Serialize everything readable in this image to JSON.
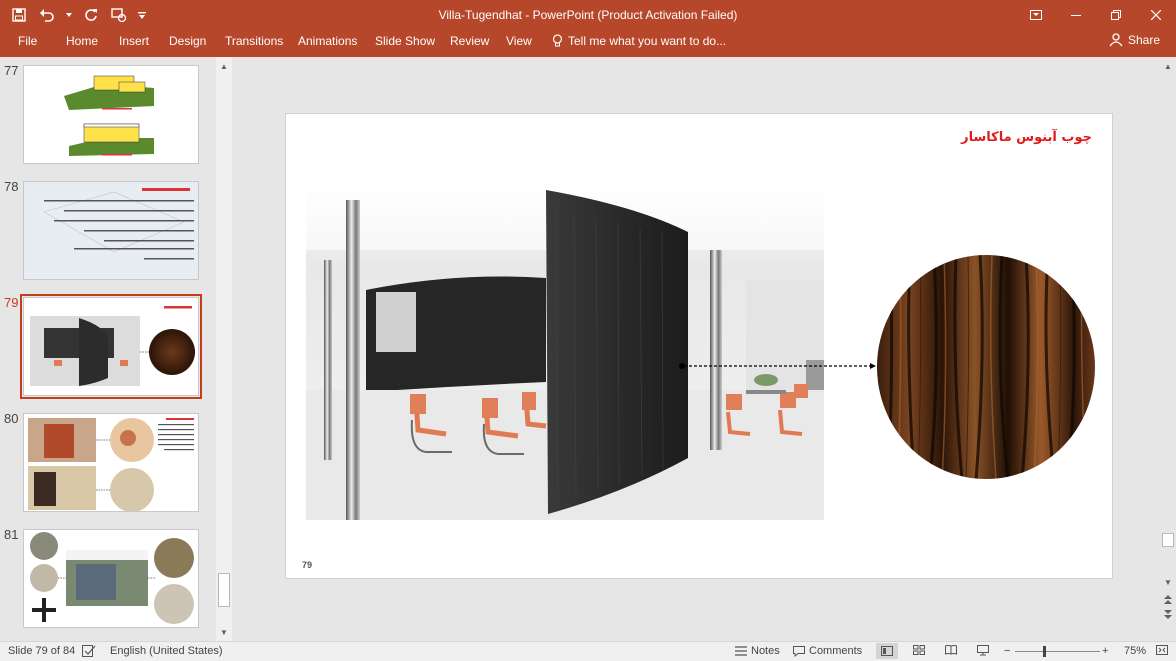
{
  "window": {
    "title": "Villa-Tugendhat - PowerPoint (Product Activation Failed)"
  },
  "ribbon": {
    "tabs": [
      "File",
      "Home",
      "Insert",
      "Design",
      "Transitions",
      "Animations",
      "Slide Show",
      "Review",
      "View"
    ],
    "tell_me": "Tell me what you want to do...",
    "share": "Share"
  },
  "thumbnails": [
    {
      "number": "77"
    },
    {
      "number": "78"
    },
    {
      "number": "79"
    },
    {
      "number": "80"
    },
    {
      "number": "81"
    }
  ],
  "slide": {
    "title": "چوب آبنوس ماکاسار",
    "number": "79"
  },
  "status": {
    "slide_of": "Slide 79 of 84",
    "language": "English (United States)",
    "notes": "Notes",
    "comments": "Comments",
    "zoom": "75%"
  },
  "colors": {
    "accent": "#b7472a",
    "title_red": "#e01b1b",
    "active_thumb": "#c43e1c"
  }
}
